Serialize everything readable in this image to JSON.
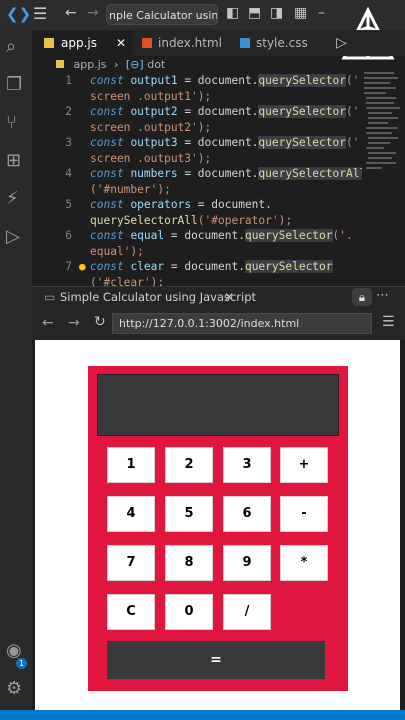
{
  "window": {
    "search_text": "nple Calculator using Jav"
  },
  "tabs": [
    {
      "label": "app.js",
      "icon": "js-file-icon"
    },
    {
      "label": "index.html",
      "icon": "html-file-icon"
    },
    {
      "label": "style.css",
      "icon": "css-file-icon"
    }
  ],
  "breadcrumb": {
    "file": "app.js",
    "symbol": "dot"
  },
  "code": {
    "line_numbers": [
      "1",
      "2",
      "3",
      "4",
      "5",
      "6",
      "7"
    ],
    "l1": {
      "kw": "const",
      "var": "output1",
      "mid": " = document.",
      "fn": "querySelector",
      "open": "('.",
      "cont": "screen .output1');"
    },
    "l2": {
      "kw": "const",
      "var": "output2",
      "mid": " = document.",
      "fn": "querySelector",
      "open": "('.",
      "cont": "screen .output2');"
    },
    "l3": {
      "kw": "const",
      "var": "output3",
      "mid": " = document.",
      "fn": "querySelector",
      "open": "('.",
      "cont": "screen .output3');"
    },
    "l4": {
      "kw": "const",
      "var": "numbers",
      "mid": " = document.",
      "fn": "querySelectorAll",
      "cont": "('#number');"
    },
    "l5": {
      "kw": "const",
      "var": "operators",
      "mid": " = document.",
      "fn": "querySelectorAll",
      "cont": "('#operator');"
    },
    "l6": {
      "kw": "const",
      "var": "equal",
      "mid": " = document.",
      "fn": "querySelector",
      "open": "('.",
      "cont": "equal');"
    },
    "l7": {
      "kw": "const",
      "var": "clear",
      "mid": " = document.",
      "fn": "querySelector",
      "cont": "('#clear');"
    }
  },
  "browser": {
    "tab_title": "Simple Calculator using Javascript",
    "url": "http://127.0.0.1:3002/index.html"
  },
  "calculator": {
    "keys": [
      "1",
      "2",
      "3",
      "+",
      "4",
      "5",
      "6",
      "-",
      "7",
      "8",
      "9",
      "*",
      "C",
      "0",
      "/"
    ],
    "equal_label": "="
  },
  "account_badge": "1",
  "colors": {
    "calc_bg": "#e0163f",
    "display_bg": "#38393b",
    "status_bar": "#007acc"
  }
}
